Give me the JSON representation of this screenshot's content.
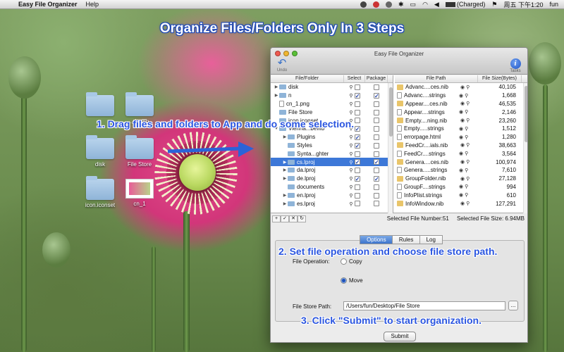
{
  "menubar": {
    "app_name": "Easy File Organizer",
    "help": "Help",
    "battery": "(Charged)",
    "clock": "周五 下午1:20",
    "user": "fun"
  },
  "heading": "Organize Files/Folders Only In 3 Steps",
  "steps": {
    "step1": "1. Drag files and folders to App and do some selection.",
    "step2": "2. Set file operation and choose file store path.",
    "step3": "3. Click \"Submit\" to start organization."
  },
  "desktop_icons": [
    {
      "label": ""
    },
    {
      "label": "...befffb"
    },
    {
      "label": "disk"
    },
    {
      "label": "File Store"
    },
    {
      "label": "icon.iconset"
    },
    {
      "label": "cn_1"
    }
  ],
  "window": {
    "title": "Easy File Organizer",
    "undo_label": "Undo",
    "tasks_label": "Tasks",
    "left_headers": {
      "name": "File/Folder",
      "select": "Select",
      "package": "Package"
    },
    "right_headers": {
      "path": "File Path",
      "size": "File Size(Bytes)"
    },
    "left_rows": [
      {
        "name": "disk",
        "indent": 0,
        "arrow": "▶",
        "icon": "folder",
        "select": false,
        "package": false,
        "selected": false
      },
      {
        "name": "n",
        "indent": 0,
        "arrow": "▶",
        "icon": "folder",
        "select": true,
        "package": true,
        "selected": false
      },
      {
        "name": "cn_1.png",
        "indent": 0,
        "arrow": "",
        "icon": "file",
        "select": false,
        "package": false,
        "selected": false
      },
      {
        "name": "File Store",
        "indent": 0,
        "arrow": "",
        "icon": "folder",
        "select": false,
        "package": false,
        "selected": false
      },
      {
        "name": "icon.iconset",
        "indent": 0,
        "arrow": "",
        "icon": "folder",
        "select": false,
        "package": false,
        "selected": false
      },
      {
        "name": "Vienna...befffb",
        "indent": 0,
        "arrow": "▼",
        "icon": "folder",
        "select": true,
        "package": false,
        "selected": false
      },
      {
        "name": "Plugins",
        "indent": 1,
        "arrow": "▶",
        "icon": "folder",
        "select": true,
        "package": false,
        "selected": false
      },
      {
        "name": "Styles",
        "indent": 1,
        "arrow": "",
        "icon": "folder",
        "select": true,
        "package": false,
        "selected": false
      },
      {
        "name": "Synta...ghter",
        "indent": 1,
        "arrow": "",
        "icon": "folder",
        "select": false,
        "package": false,
        "selected": false
      },
      {
        "name": "cs.lproj",
        "indent": 1,
        "arrow": "▶",
        "icon": "folder",
        "select": true,
        "package": true,
        "selected": true
      },
      {
        "name": "da.lproj",
        "indent": 1,
        "arrow": "▶",
        "icon": "folder",
        "select": false,
        "package": false,
        "selected": false
      },
      {
        "name": "de.lproj",
        "indent": 1,
        "arrow": "▶",
        "icon": "folder",
        "select": true,
        "package": true,
        "selected": false
      },
      {
        "name": "documents",
        "indent": 1,
        "arrow": "",
        "icon": "folder",
        "select": false,
        "package": false,
        "selected": false
      },
      {
        "name": "en.lproj",
        "indent": 1,
        "arrow": "▶",
        "icon": "folder",
        "select": false,
        "package": false,
        "selected": false
      },
      {
        "name": "es.lproj",
        "indent": 1,
        "arrow": "▶",
        "icon": "folder",
        "select": false,
        "package": false,
        "selected": false
      }
    ],
    "right_rows": [
      {
        "path": "Advanc....ces.nib",
        "size": "40,105",
        "icon": "nib"
      },
      {
        "path": "Advanc....strings",
        "size": "1,668",
        "icon": "file"
      },
      {
        "path": "Appear....ces.nib",
        "size": "46,535",
        "icon": "nib"
      },
      {
        "path": "Appear....strings",
        "size": "2,146",
        "icon": "file"
      },
      {
        "path": "Empty....ning.nib",
        "size": "23,260",
        "icon": "nib"
      },
      {
        "path": "Empty.....strings",
        "size": "1,512",
        "icon": "file"
      },
      {
        "path": "errorpage.html",
        "size": "1,280",
        "icon": "file"
      },
      {
        "path": "FeedCr....ials.nib",
        "size": "38,663",
        "icon": "nib"
      },
      {
        "path": "FeedCr....strings",
        "size": "3,564",
        "icon": "file"
      },
      {
        "path": "Genera....ces.nib",
        "size": "100,974",
        "icon": "nib"
      },
      {
        "path": "Genera.....strings",
        "size": "7,610",
        "icon": "file"
      },
      {
        "path": "GroupFolder.nib",
        "size": "27,128",
        "icon": "nib"
      },
      {
        "path": "GroupF....strings",
        "size": "994",
        "icon": "file"
      },
      {
        "path": "InfoPlist.strings",
        "size": "610",
        "icon": "file"
      },
      {
        "path": "InfoWindow.nib",
        "size": "127,291",
        "icon": "nib"
      }
    ],
    "status": {
      "file_number": "Selected File Number:51",
      "file_size": "Selected File Size: 6.94MB"
    },
    "tabs": [
      "Options",
      "Rules",
      "Log"
    ],
    "active_tab": "Options",
    "file_operation_label": "File Operation:",
    "copy_label": "Copy",
    "move_label": "Move",
    "file_operation_value": "Move",
    "file_store_label": "File Store Path:",
    "file_store_value": "/Users/fun/Desktop/File Store",
    "browse_label": "...",
    "submit_label": "Submit"
  },
  "colors": {
    "heading_outline": "#1b46b8",
    "step_text": "#2a55e0",
    "selection": "#3d78d8"
  }
}
